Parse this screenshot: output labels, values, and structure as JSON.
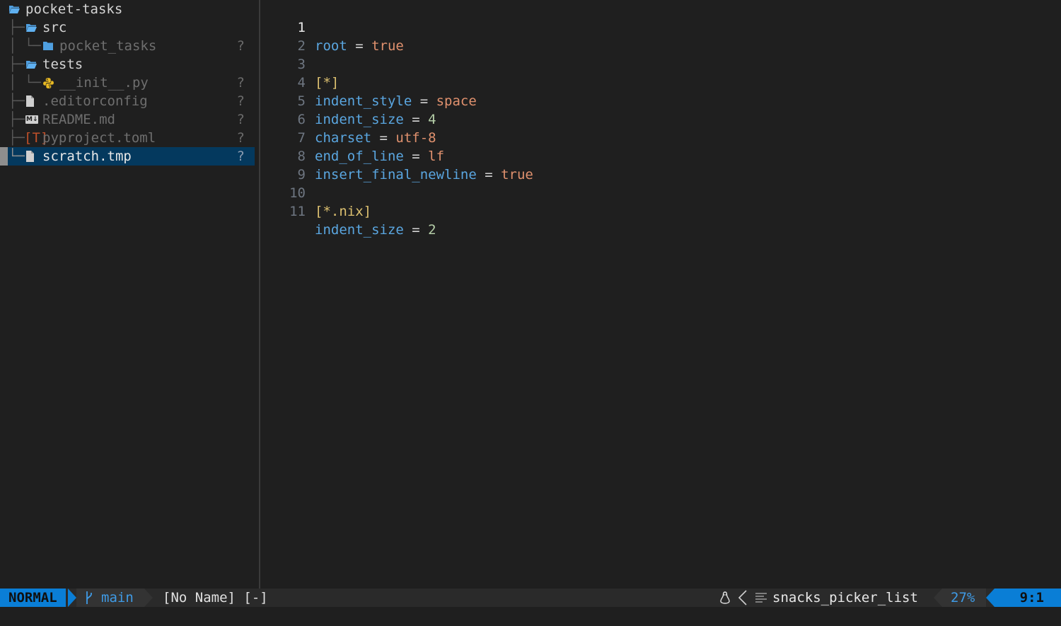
{
  "explorer": {
    "root": "pocket-tasks",
    "items": [
      {
        "name": "src"
      },
      {
        "name": "pocket_tasks",
        "status": "?"
      },
      {
        "name": "tests"
      },
      {
        "name": "__init__.py",
        "status": "?"
      },
      {
        "name": ".editorconfig",
        "status": "?"
      },
      {
        "name": "README.md",
        "status": "?"
      },
      {
        "name": "pyproject.toml",
        "status": "?"
      },
      {
        "name": "scratch.tmp",
        "status": "?"
      }
    ]
  },
  "editor": {
    "lines": [
      {
        "num": "1",
        "key": "root",
        "op": " = ",
        "value": "true"
      },
      {
        "num": "2"
      },
      {
        "num": "3",
        "section": "[*]"
      },
      {
        "num": "4",
        "key": "indent_style",
        "op": " = ",
        "value": "space"
      },
      {
        "num": "5",
        "key": "indent_size",
        "op": " = ",
        "value": "4"
      },
      {
        "num": "6",
        "key": "charset",
        "op": " = ",
        "value": "utf-8"
      },
      {
        "num": "7",
        "key": "end_of_line",
        "op": " = ",
        "value": "lf"
      },
      {
        "num": "8",
        "key": "insert_final_newline",
        "op": " = ",
        "value": "true"
      },
      {
        "num": "9"
      },
      {
        "num": "10",
        "section": "[*.nix]"
      },
      {
        "num": "11",
        "key": "indent_size",
        "op": " = ",
        "value": "2"
      }
    ]
  },
  "statusline": {
    "mode": "NORMAL",
    "branch_icon": "",
    "branch": "main",
    "filename": "[No Name] [-]",
    "filetype": "snacks_picker_list",
    "percent": "27%",
    "position": "9:1"
  },
  "icons": {
    "folder": "folder-open-icon",
    "python": "python-icon",
    "file": "file-icon",
    "markdown": "markdown-icon",
    "toml": "toml-icon",
    "os": "linux-icon",
    "filetype": "lines-icon"
  },
  "colors": {
    "accent": "#0a7ed6",
    "keyword": "#5aa6e0",
    "string": "#e0916e",
    "number": "#b5cea8",
    "section": "#dcc070",
    "selection": "#04395e"
  }
}
